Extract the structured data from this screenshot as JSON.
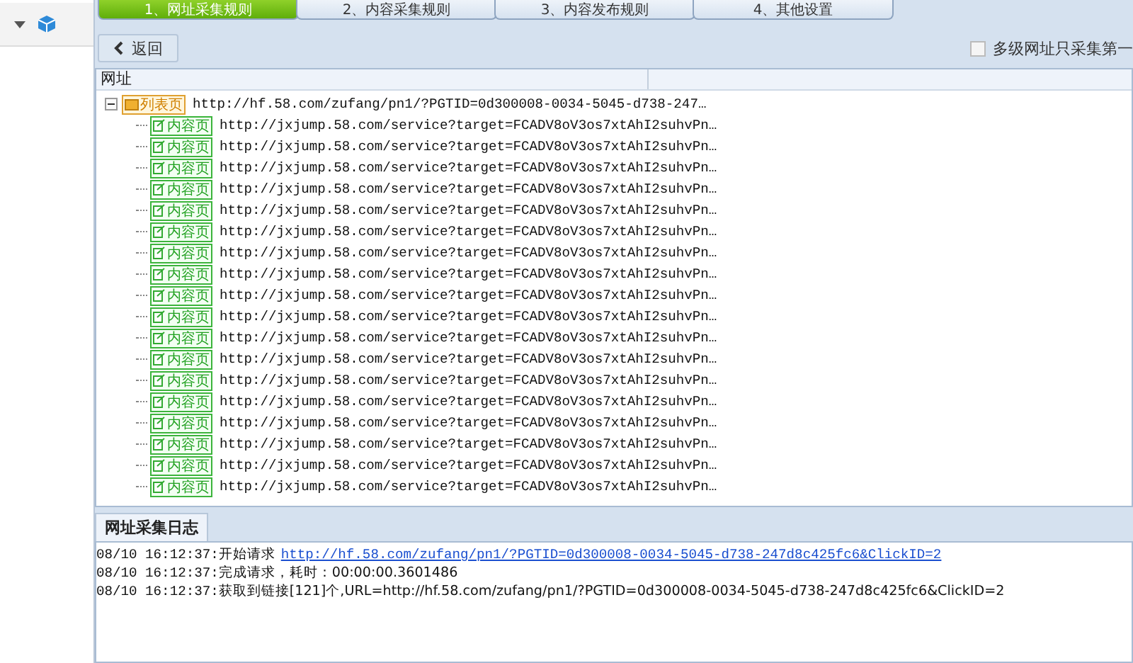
{
  "tabs": [
    {
      "label": "1、网址采集规则",
      "selected": true
    },
    {
      "label": "2、内容采集规则",
      "selected": false
    },
    {
      "label": "3、内容发布规则",
      "selected": false
    },
    {
      "label": "4、其他设置",
      "selected": false
    }
  ],
  "toolbar": {
    "back_button": "返回",
    "option": {
      "label": "多级网址只采集第一",
      "checked": false
    }
  },
  "grid": {
    "columns": [
      "网址"
    ],
    "tree": {
      "tag": "列表页",
      "url": "http://hf.58.com/zufang/pn1/?PGTID=0d300008-0034-5045-d738-247…",
      "expanded": true,
      "children": [
        {
          "tag": "内容页",
          "url": "http://jxjump.58.com/service?target=FCADV8oV3os7xtAhI2suhvPn…"
        },
        {
          "tag": "内容页",
          "url": "http://jxjump.58.com/service?target=FCADV8oV3os7xtAhI2suhvPn…"
        },
        {
          "tag": "内容页",
          "url": "http://jxjump.58.com/service?target=FCADV8oV3os7xtAhI2suhvPn…"
        },
        {
          "tag": "内容页",
          "url": "http://jxjump.58.com/service?target=FCADV8oV3os7xtAhI2suhvPn…"
        },
        {
          "tag": "内容页",
          "url": "http://jxjump.58.com/service?target=FCADV8oV3os7xtAhI2suhvPn…"
        },
        {
          "tag": "内容页",
          "url": "http://jxjump.58.com/service?target=FCADV8oV3os7xtAhI2suhvPn…"
        },
        {
          "tag": "内容页",
          "url": "http://jxjump.58.com/service?target=FCADV8oV3os7xtAhI2suhvPn…"
        },
        {
          "tag": "内容页",
          "url": "http://jxjump.58.com/service?target=FCADV8oV3os7xtAhI2suhvPn…"
        },
        {
          "tag": "内容页",
          "url": "http://jxjump.58.com/service?target=FCADV8oV3os7xtAhI2suhvPn…"
        },
        {
          "tag": "内容页",
          "url": "http://jxjump.58.com/service?target=FCADV8oV3os7xtAhI2suhvPn…"
        },
        {
          "tag": "内容页",
          "url": "http://jxjump.58.com/service?target=FCADV8oV3os7xtAhI2suhvPn…"
        },
        {
          "tag": "内容页",
          "url": "http://jxjump.58.com/service?target=FCADV8oV3os7xtAhI2suhvPn…"
        },
        {
          "tag": "内容页",
          "url": "http://jxjump.58.com/service?target=FCADV8oV3os7xtAhI2suhvPn…"
        },
        {
          "tag": "内容页",
          "url": "http://jxjump.58.com/service?target=FCADV8oV3os7xtAhI2suhvPn…"
        },
        {
          "tag": "内容页",
          "url": "http://jxjump.58.com/service?target=FCADV8oV3os7xtAhI2suhvPn…"
        },
        {
          "tag": "内容页",
          "url": "http://jxjump.58.com/service?target=FCADV8oV3os7xtAhI2suhvPn…"
        },
        {
          "tag": "内容页",
          "url": "http://jxjump.58.com/service?target=FCADV8oV3os7xtAhI2suhvPn…"
        },
        {
          "tag": "内容页",
          "url": "http://jxjump.58.com/service?target=FCADV8oV3os7xtAhI2suhvPn…"
        }
      ]
    }
  },
  "log": {
    "tab": "网址采集日志",
    "lines": [
      {
        "time": "08/10 16:12:37:",
        "text": "开始请求",
        "link": "http://hf.58.com/zufang/pn1/?PGTID=0d300008-0034-5045-d738-247d8c425fc6&ClickID=2"
      },
      {
        "time": "08/10 16:12:37:",
        "text": "完成请求，耗时：00:00:00.3601486"
      },
      {
        "time": "08/10 16:12:37:",
        "text": "获取到链接[121]个,URL=http://hf.58.com/zufang/pn1/?PGTID=0d300008-0034-5045-d738-247d8c425fc6&ClickID=2"
      }
    ]
  }
}
